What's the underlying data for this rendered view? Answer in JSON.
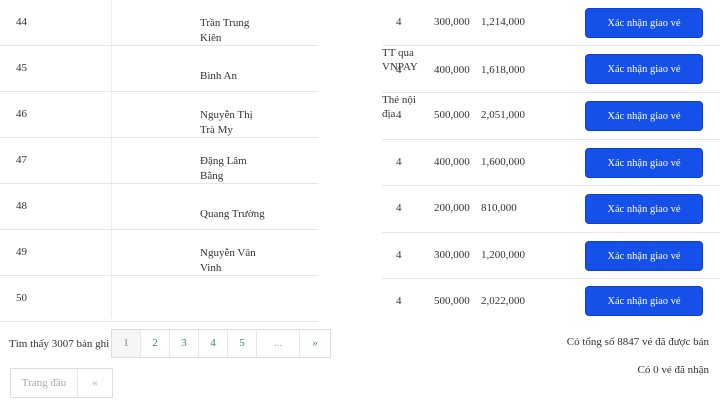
{
  "left_rows": [
    {
      "num": "44",
      "name1": "Trần Trung",
      "name2": "Kiên"
    },
    {
      "num": "45",
      "name1": "Bình An",
      "name2": ""
    },
    {
      "num": "46",
      "name1": "Nguyễn Thị",
      "name2": "Trà My"
    },
    {
      "num": "47",
      "name1": "Đặng Lâm",
      "name2": "Bằng"
    },
    {
      "num": "48",
      "name1": "Quang Trường",
      "name2": ""
    },
    {
      "num": "49",
      "name1": "Nguyễn Văn",
      "name2": "Vinh"
    },
    {
      "num": "50",
      "name1": "",
      "name2": ""
    }
  ],
  "right_rows": [
    {
      "qty": "4",
      "price": "300,000",
      "total": "1,214,000",
      "pay1": "",
      "pay2": "",
      "button": "Xác nhận giao vé"
    },
    {
      "qty": "4",
      "price": "400,000",
      "total": "1,618,000",
      "pay1": "TT qua",
      "pay2": "VNPAY",
      "button": "Xác nhận giao vé"
    },
    {
      "qty": "4",
      "price": "500,000",
      "total": "2,051,000",
      "pay1": "Thẻ nội",
      "pay2": "địa",
      "button": "Xác nhận giao vé"
    },
    {
      "qty": "4",
      "price": "400,000",
      "total": "1,600,000",
      "pay1": "",
      "pay2": "",
      "button": "Xác nhận giao vé"
    },
    {
      "qty": "4",
      "price": "200,000",
      "total": "810,000",
      "pay1": "",
      "pay2": "",
      "button": "Xác nhận giao vé"
    },
    {
      "qty": "4",
      "price": "300,000",
      "total": "1,200,000",
      "pay1": "",
      "pay2": "",
      "button": "Xác nhận giao vé"
    },
    {
      "qty": "4",
      "price": "500,000",
      "total": "2,022,000",
      "pay1": "",
      "pay2": "",
      "button": "Xác nhận giao vé"
    }
  ],
  "footer": {
    "found_text": "Tìm thấy 3007 bản ghi",
    "pages": [
      "1",
      "2",
      "3",
      "4",
      "5",
      "...",
      "»"
    ],
    "first_page": "Trang đầu",
    "prev": "«",
    "sold_summary": "Có tổng số 8847 vé đã được bán",
    "received_summary": "Có 0 vé đã nhận"
  },
  "colors": {
    "button_bg": "#1550e8",
    "link": "#2f8f7e"
  }
}
